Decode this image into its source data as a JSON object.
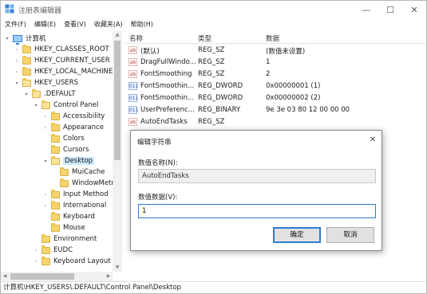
{
  "window": {
    "title": "注册表编辑器",
    "controls": {
      "minimize": "—",
      "maximize": "☐",
      "close": "✕"
    }
  },
  "menu": [
    "文件(F)",
    "编辑(E)",
    "查看(V)",
    "收藏夹(A)",
    "帮助(H)"
  ],
  "tree": {
    "expander_open": "▾",
    "expander_closed": "›",
    "items": [
      {
        "label": "计算机",
        "icon": "computer-icon"
      },
      {
        "label": "HKEY_CLASSES_ROOT"
      },
      {
        "label": "HKEY_CURRENT_USER"
      },
      {
        "label": "HKEY_LOCAL_MACHINE"
      },
      {
        "label": "HKEY_USERS"
      },
      {
        "label": ".DEFAULT"
      },
      {
        "label": "Control Panel"
      },
      {
        "label": "Accessibility"
      },
      {
        "label": "Appearance"
      },
      {
        "label": "Colors"
      },
      {
        "label": "Cursors"
      },
      {
        "label": "Desktop"
      },
      {
        "label": "MuiCache"
      },
      {
        "label": "WindowMetrics"
      },
      {
        "label": "Input Method"
      },
      {
        "label": "International"
      },
      {
        "label": "Keyboard"
      },
      {
        "label": "Mouse"
      },
      {
        "label": "Environment"
      },
      {
        "label": "EUDC"
      },
      {
        "label": "Keyboard Layout"
      }
    ]
  },
  "list": {
    "columns": [
      "名称",
      "类型",
      "数据"
    ],
    "rows": [
      {
        "name": "(默认)",
        "type": "REG_SZ",
        "data": "(数值未设置)",
        "icon": "string-value-icon"
      },
      {
        "name": "DragFullWindo...",
        "type": "REG_SZ",
        "data": "1",
        "icon": "string-value-icon"
      },
      {
        "name": "FontSmoothing",
        "type": "REG_SZ",
        "data": "2",
        "icon": "string-value-icon"
      },
      {
        "name": "FontSmoothin...",
        "type": "REG_DWORD",
        "data": "0x00000001 (1)",
        "icon": "binary-value-icon"
      },
      {
        "name": "FontSmoothin...",
        "type": "REG_DWORD",
        "data": "0x00000002 (2)",
        "icon": "binary-value-icon"
      },
      {
        "name": "UserPreferenc...",
        "type": "REG_BINARY",
        "data": "9e 3e 03 80 12 00 00 00",
        "icon": "binary-value-icon"
      },
      {
        "name": "AutoEndTasks",
        "type": "REG_SZ",
        "data": "",
        "icon": "string-value-icon"
      }
    ]
  },
  "status": "计算机\\HKEY_USERS\\.DEFAULT\\Control Panel\\Desktop",
  "dialog": {
    "title": "编辑字符串",
    "close": "✕",
    "name_label": "数值名称(N):",
    "name_value": "AutoEndTasks",
    "data_label": "数值数据(V):",
    "data_value": "1",
    "ok": "确定",
    "cancel": "取消"
  },
  "icons": {
    "string": "ab",
    "binary": "011"
  }
}
